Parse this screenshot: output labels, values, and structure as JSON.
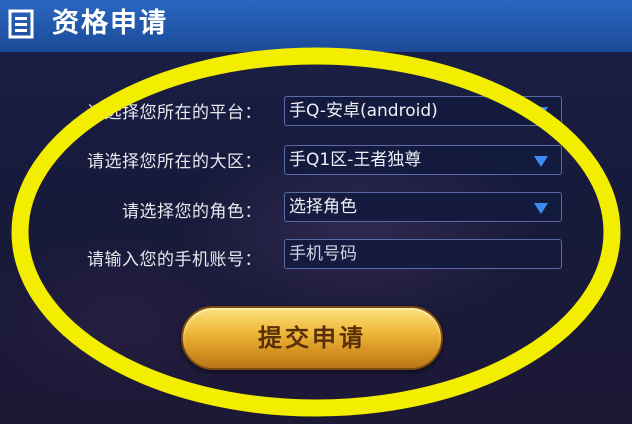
{
  "header": {
    "title": "资格申请",
    "icon": "list-document-icon"
  },
  "form": {
    "platform": {
      "label": "请选择您所在的平台：",
      "value": "手Q-安卓(android)"
    },
    "region": {
      "label": "请选择您所在的大区：",
      "value": "手Q1区-王者独尊"
    },
    "role": {
      "label": "请选择您的角色：",
      "value": "选择角色"
    },
    "phone": {
      "label": "请输入您的手机账号：",
      "placeholder": "手机号码"
    },
    "submit_label": "提交申请"
  },
  "colors": {
    "header_blue": "#1f56ad",
    "arrow_blue": "#3a8cf2",
    "button_gold": "#e6ad32",
    "annotation_yellow": "#f3ee00"
  }
}
